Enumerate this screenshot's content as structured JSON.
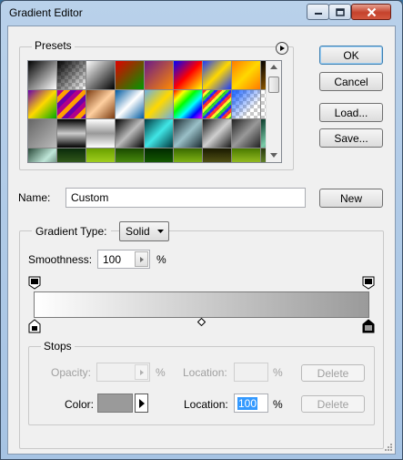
{
  "window": {
    "title": "Gradient Editor"
  },
  "buttons": {
    "ok": "OK",
    "cancel": "Cancel",
    "load": "Load...",
    "save": "Save...",
    "new": "New"
  },
  "presets": {
    "label": "Presets",
    "menu_icon": "circle-arrow-right-icon"
  },
  "name_field": {
    "label": "Name:",
    "value": "Custom"
  },
  "gradient": {
    "type_label": "Gradient Type:",
    "type_value": "Solid",
    "smoothness_label": "Smoothness:",
    "smoothness_value": "100",
    "smoothness_unit": "%",
    "start_color": "#ffffff",
    "end_color": "#9a9a9a"
  },
  "stops": {
    "label": "Stops",
    "opacity_label": "Opacity:",
    "opacity_value": "",
    "opacity_unit": "%",
    "opacity_location_label": "Location:",
    "opacity_location_value": "",
    "opacity_location_unit": "%",
    "delete_opacity": "Delete",
    "color_label": "Color:",
    "color_value": "#9a9a9a",
    "color_location_label": "Location:",
    "color_location_value": "100",
    "color_location_unit": "%",
    "delete_color": "Delete"
  }
}
